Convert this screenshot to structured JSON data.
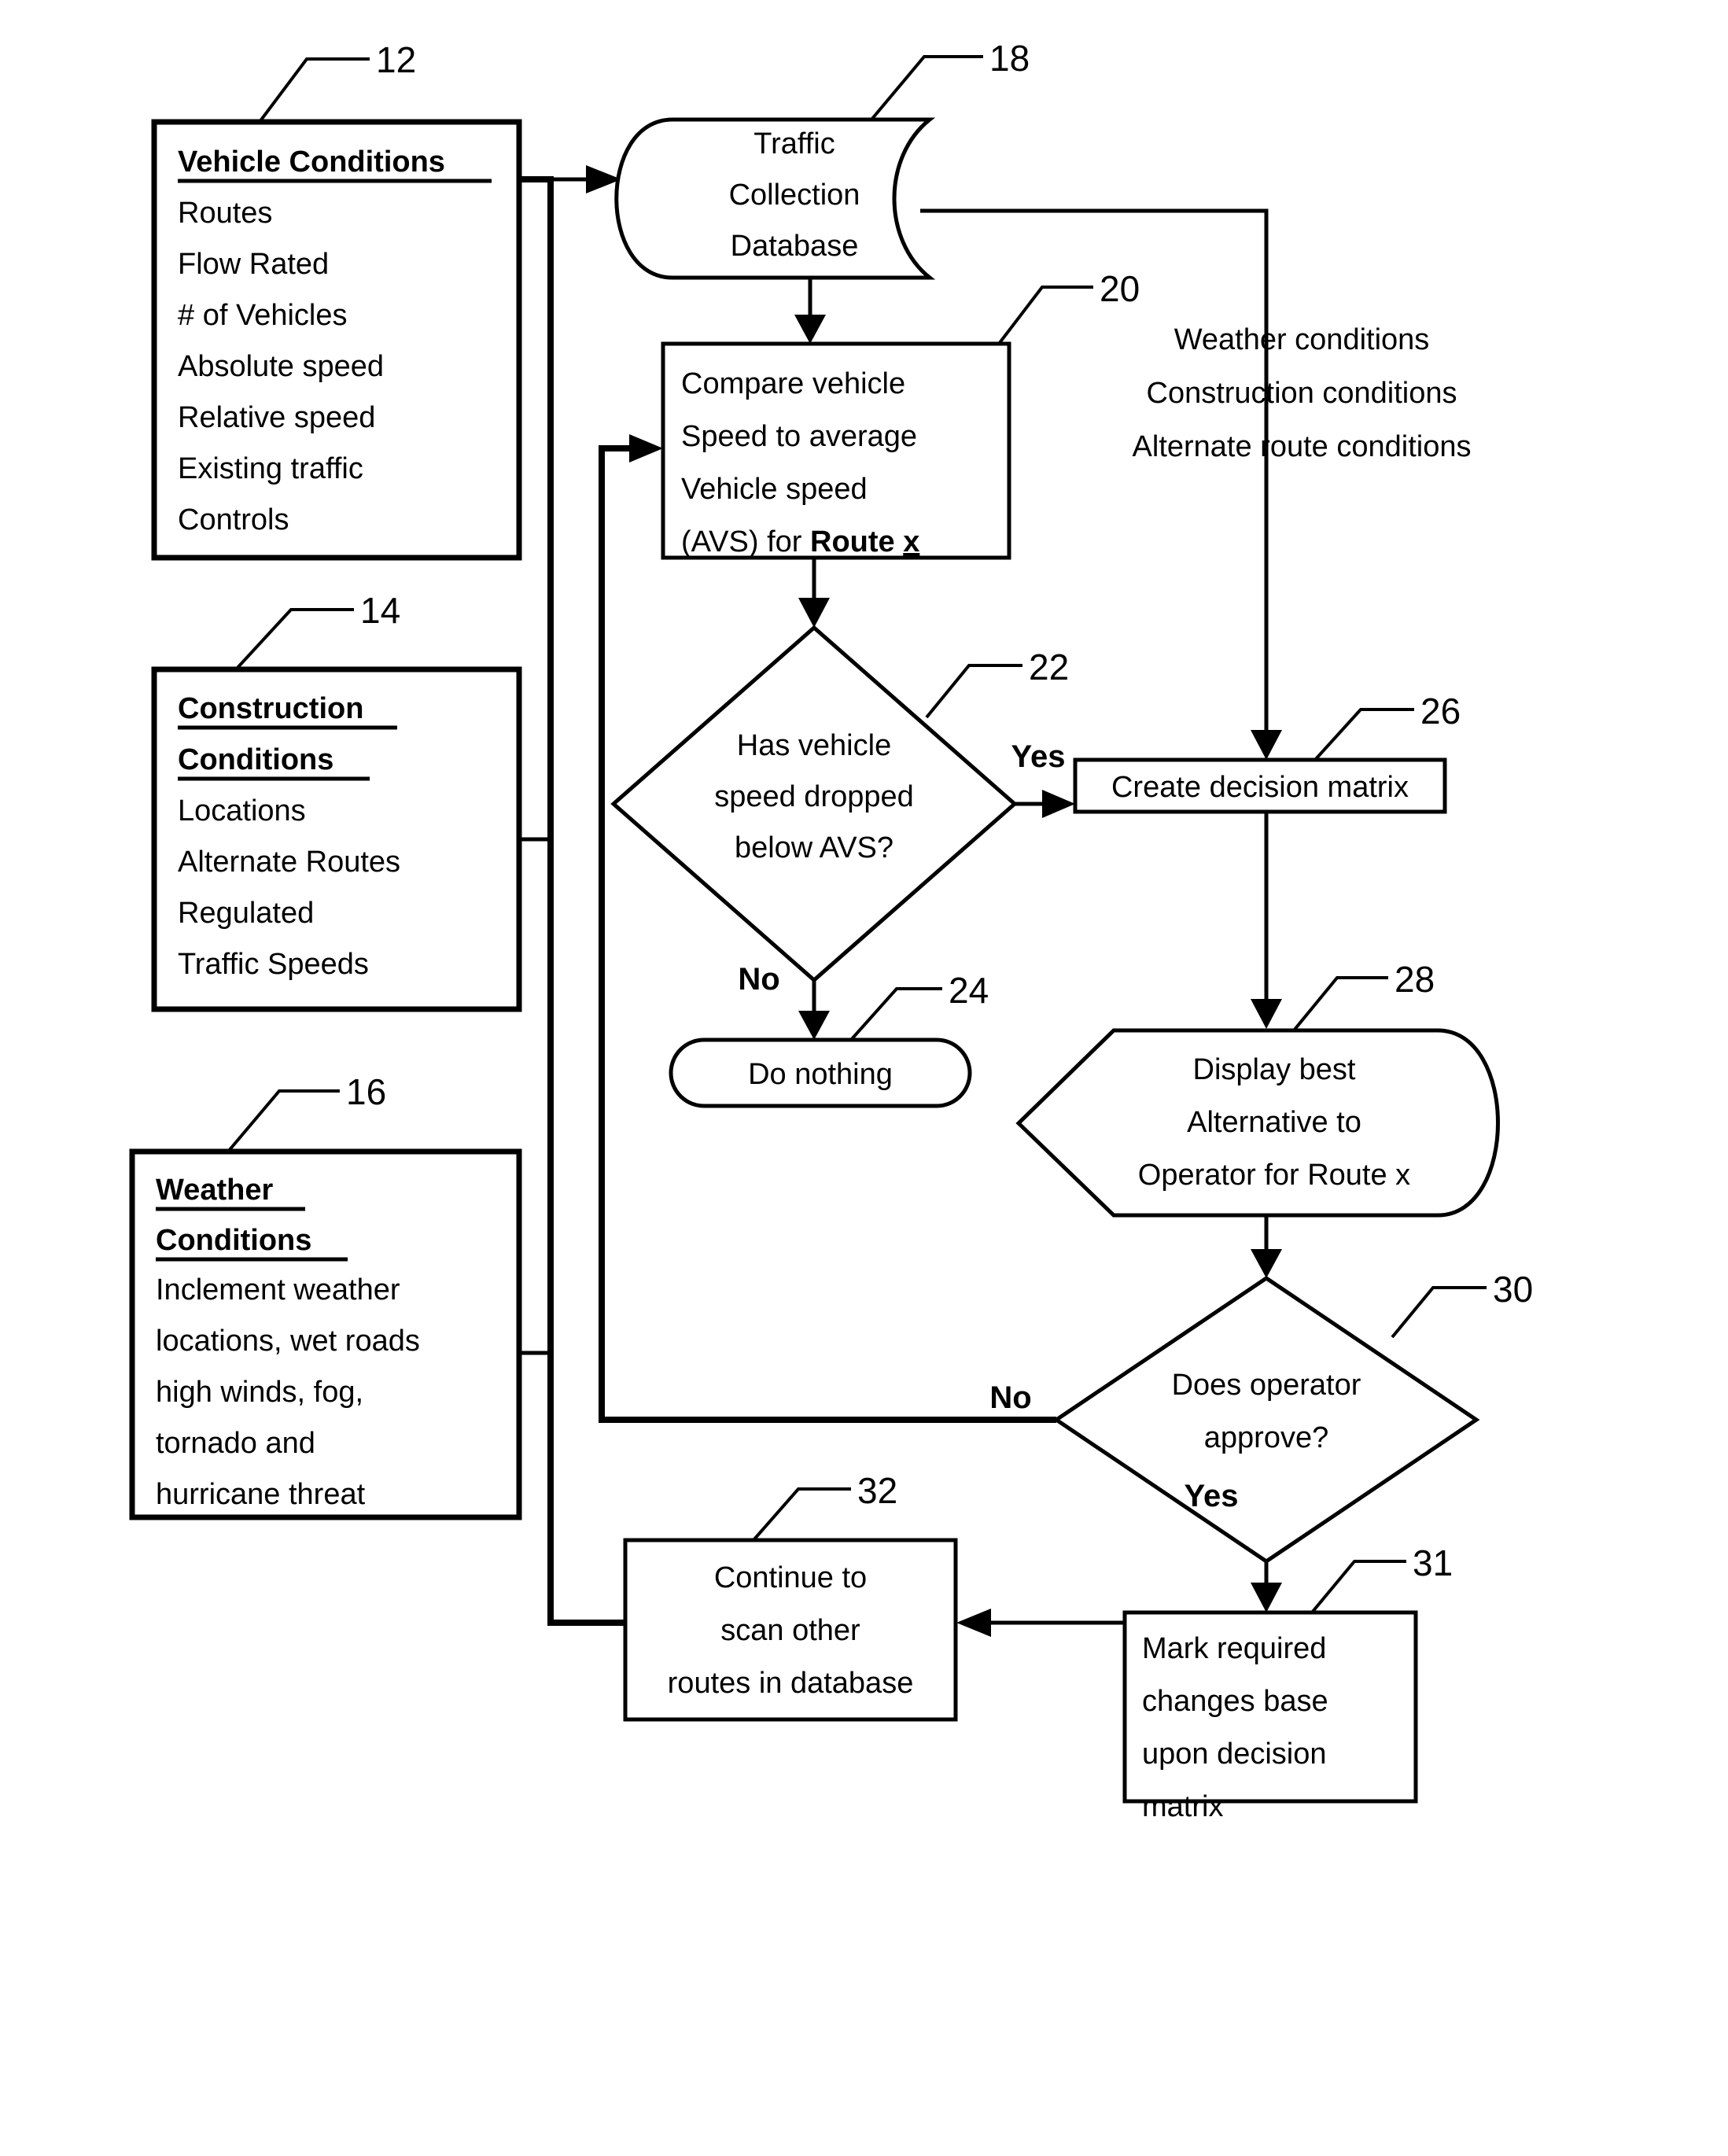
{
  "figure": {
    "type": "patent-flowchart",
    "background": "#ffffff",
    "line_color": "#000000"
  },
  "inputs": {
    "vehicle": {
      "ref": "12",
      "title": "Vehicle Conditions",
      "items": [
        "Routes",
        "Flow Rated",
        "# of Vehicles",
        "Absolute speed",
        "Relative speed",
        "Existing traffic",
        "Controls"
      ]
    },
    "construction": {
      "ref": "14",
      "title_line1": "Construction",
      "title_line2": "Conditions",
      "items": [
        "Locations",
        "Alternate Routes",
        "Regulated",
        "Traffic Speeds"
      ]
    },
    "weather": {
      "ref": "16",
      "title_line1": "Weather",
      "title_line2": "Conditions",
      "items": [
        "Inclement weather",
        "locations, wet roads",
        "high winds, fog,",
        "tornado and",
        "hurricane threat"
      ]
    }
  },
  "nodes": {
    "database": {
      "ref": "18",
      "shape": "cylinder",
      "lines": [
        "Traffic",
        "Collection",
        "Database"
      ]
    },
    "compare": {
      "ref": "20",
      "shape": "rectangle",
      "lines": [
        "Compare vehicle",
        "Speed to average",
        "Vehicle speed"
      ],
      "line4_prefix": "(AVS) for ",
      "line4_bold": "Route ",
      "line4_bold_underline": "x"
    },
    "decision_speed": {
      "ref": "22",
      "shape": "diamond",
      "lines": [
        "Has vehicle",
        "speed dropped",
        "below AVS?"
      ],
      "yes_label": "Yes",
      "no_label": "No"
    },
    "do_nothing": {
      "ref": "24",
      "shape": "stadium",
      "lines": [
        "Do nothing"
      ]
    },
    "create_matrix": {
      "ref": "26",
      "shape": "rectangle",
      "lines": [
        "Create decision matrix"
      ]
    },
    "display_best": {
      "ref": "28",
      "shape": "display",
      "lines": [
        "Display best",
        "Alternative to",
        "Operator for Route x"
      ]
    },
    "decision_approve": {
      "ref": "30",
      "shape": "diamond",
      "lines": [
        "Does operator",
        "approve?"
      ],
      "yes_label": "Yes",
      "no_label": "No"
    },
    "mark_changes": {
      "ref": "31",
      "shape": "rectangle",
      "lines": [
        "Mark required",
        "changes base",
        "upon decision",
        "matrix"
      ]
    },
    "continue_scan": {
      "ref": "32",
      "shape": "rectangle",
      "lines": [
        "Continue to",
        "scan other",
        "routes in database"
      ]
    }
  },
  "annotations": {
    "conditions_feed": {
      "lines": [
        "Weather conditions",
        "Construction conditions",
        "Alternate route conditions"
      ]
    }
  }
}
